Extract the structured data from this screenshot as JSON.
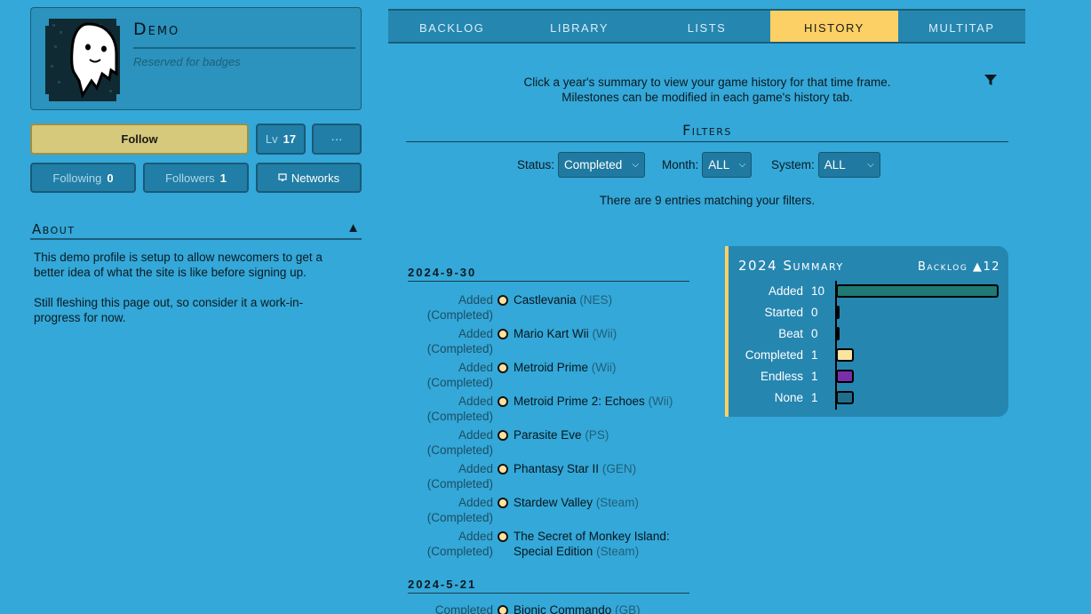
{
  "profile": {
    "username": "Demo",
    "badges_note": "Reserved for badges"
  },
  "actions": {
    "follow_label": "Follow",
    "level_label": "Lv",
    "level_value": "17",
    "more_label": "···",
    "following_label": "Following",
    "following_count": "0",
    "followers_label": "Followers",
    "followers_count": "1",
    "networks_label": "Networks"
  },
  "about": {
    "title": "About",
    "toggle": "▲",
    "paragraphs": [
      "This demo profile is setup to allow newcomers to get a better idea of what the site is like before signing up.",
      "Still fleshing this page out, so consider it a work-in-progress for now."
    ]
  },
  "tabs": [
    {
      "label": "BACKLOG",
      "active": false
    },
    {
      "label": "LIBRARY",
      "active": false
    },
    {
      "label": "LISTS",
      "active": false
    },
    {
      "label": "HISTORY",
      "active": true
    },
    {
      "label": "MULTITAP",
      "active": false
    }
  ],
  "intro": {
    "line1": "Click a year's summary to view your game history for that time frame.",
    "line2": "Milestones can be modified in each game's history tab."
  },
  "filters": {
    "title": "Filters",
    "status_label": "Status:",
    "status_value": "Completed",
    "month_label": "Month:",
    "month_value": "ALL",
    "system_label": "System:",
    "system_value": "ALL",
    "entries_note": "There are 9 entries matching your filters."
  },
  "history": [
    {
      "date": "2024-9-30",
      "entries": [
        {
          "action": "Added",
          "status": "(Completed)",
          "game": "Castlevania",
          "system": "(NES)"
        },
        {
          "action": "Added",
          "status": "(Completed)",
          "game": "Mario Kart Wii",
          "system": "(Wii)"
        },
        {
          "action": "Added",
          "status": "(Completed)",
          "game": "Metroid Prime",
          "system": "(Wii)"
        },
        {
          "action": "Added",
          "status": "(Completed)",
          "game": "Metroid Prime 2: Echoes",
          "system": "(Wii)"
        },
        {
          "action": "Added",
          "status": "(Completed)",
          "game": "Parasite Eve",
          "system": "(PS)"
        },
        {
          "action": "Added",
          "status": "(Completed)",
          "game": "Phantasy Star II",
          "system": "(GEN)"
        },
        {
          "action": "Added",
          "status": "(Completed)",
          "game": "Stardew Valley",
          "system": "(Steam)"
        },
        {
          "action": "Added",
          "status": "(Completed)",
          "game": "The Secret of Monkey Island: Special Edition",
          "system": "(Steam)"
        }
      ]
    },
    {
      "date": "2024-5-21",
      "entries": [
        {
          "action": "Completed",
          "status": "",
          "game": "Bionic Commando",
          "system": "(GB)"
        }
      ]
    }
  ],
  "summary": {
    "title": "2024 Summary",
    "backlog_label": "Backlog",
    "backlog_arrow": "▲",
    "backlog_value": "12",
    "colors": {
      "Added": "#1e7a72",
      "Started": "#1e7a72",
      "Beat": "#1e7a72",
      "Completed": "#fde3a0",
      "Endless": "#7a2fa6",
      "None": "#1f6f8c"
    }
  },
  "chart_data": {
    "type": "bar",
    "orientation": "horizontal",
    "title": "2024 Summary",
    "categories": [
      "Added",
      "Started",
      "Beat",
      "Completed",
      "Endless",
      "None"
    ],
    "values": [
      10,
      0,
      0,
      1,
      1,
      1
    ],
    "xlim": [
      0,
      10
    ]
  }
}
